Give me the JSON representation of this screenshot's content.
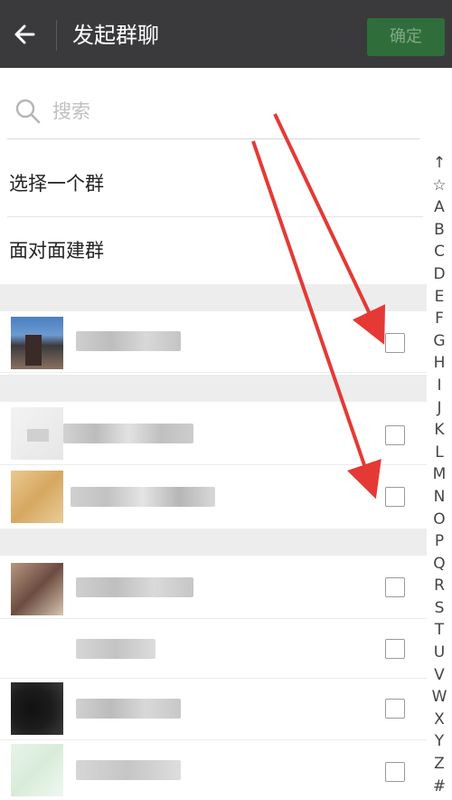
{
  "header": {
    "title": "发起群聊",
    "confirm_label": "确定",
    "back_icon": "arrow-left-icon"
  },
  "search": {
    "placeholder": "搜索"
  },
  "options": {
    "select_group": "选择一个群",
    "face_to_face": "面对面建群"
  },
  "index_letters": [
    "↑",
    "☆",
    "A",
    "B",
    "C",
    "D",
    "E",
    "F",
    "G",
    "H",
    "I",
    "J",
    "K",
    "L",
    "M",
    "N",
    "O",
    "P",
    "Q",
    "R",
    "S",
    "T",
    "U",
    "V",
    "W",
    "X",
    "Y",
    "Z",
    "#"
  ],
  "contacts_note": "contact avatars and names are pixelated / not readable",
  "colors": {
    "header_bg": "#3a3a3c",
    "confirm_bg": "#2f6e3a",
    "confirm_text": "#7fa886",
    "annotation_arrow": "#e53935"
  }
}
